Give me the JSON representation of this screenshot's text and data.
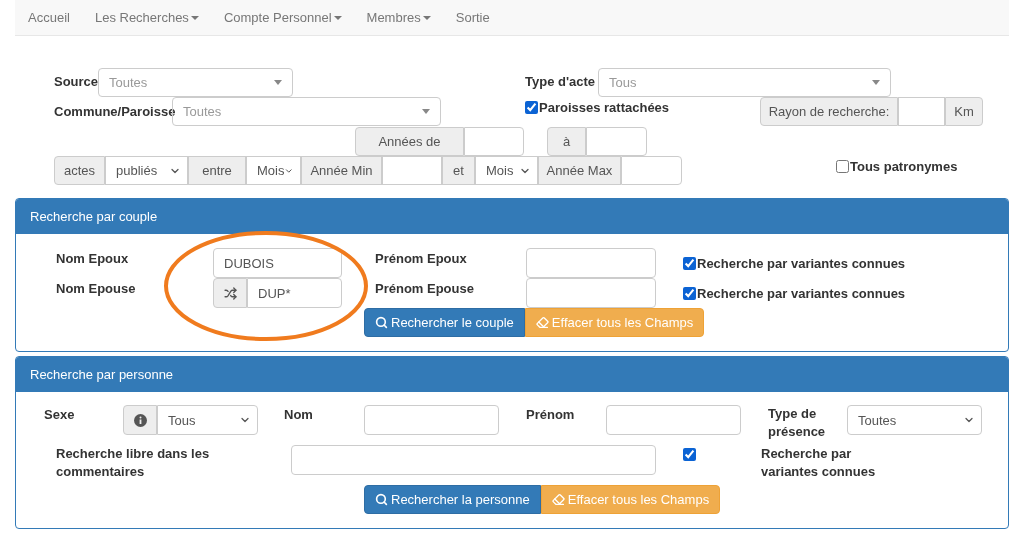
{
  "nav": [
    {
      "label": "Accueil",
      "dropdown": false
    },
    {
      "label": "Les Recherches",
      "dropdown": true
    },
    {
      "label": "Compte Personnel",
      "dropdown": true
    },
    {
      "label": "Membres",
      "dropdown": true
    },
    {
      "label": "Sortie",
      "dropdown": false
    }
  ],
  "filters": {
    "source": {
      "label": "Source",
      "placeholder": "Toutes"
    },
    "type_acte": {
      "label": "Type d'acte",
      "placeholder": "Tous"
    },
    "commune": {
      "label": "Commune/Paroisse",
      "placeholder": "Toutes"
    },
    "paroisses": {
      "label": "Paroisses rattachées",
      "checked": true
    },
    "rayon": {
      "label": "Rayon de recherche:",
      "unit": "Km"
    },
    "annees": {
      "from": "Années de",
      "to": "à"
    },
    "period": [
      {
        "kind": "addon",
        "text": "actes"
      },
      {
        "kind": "select",
        "text": "publiés"
      },
      {
        "kind": "addon",
        "text": "entre"
      },
      {
        "kind": "select",
        "text": "Mois"
      },
      {
        "kind": "addon",
        "text": "Année Min"
      },
      {
        "kind": "input"
      },
      {
        "kind": "addon",
        "text": "et"
      },
      {
        "kind": "select",
        "text": "Mois"
      },
      {
        "kind": "addon",
        "text": "Année Max"
      },
      {
        "kind": "input"
      }
    ],
    "tous_patronymes": {
      "label": "Tous patronymes",
      "checked": false
    }
  },
  "couple": {
    "title": "Recherche par couple",
    "highlight": true,
    "rows": [
      {
        "label": "Nom Epoux",
        "value": "DUBOIS",
        "shuffle": false,
        "first_name_label": "Prénom Epoux",
        "variants": {
          "label": "Recherche par variantes connues",
          "checked": true
        }
      },
      {
        "label": "Nom Epouse",
        "value": "DUP*",
        "shuffle": true,
        "first_name_label": "Prénom Epouse",
        "variants": {
          "label": "Recherche par variantes connues",
          "checked": true
        }
      }
    ],
    "buttons": [
      {
        "kind": "search",
        "label": "Rechercher le couple"
      },
      {
        "kind": "clear",
        "label": "Effacer tous les Champs"
      }
    ]
  },
  "person": {
    "title": "Recherche par personne",
    "sexe": {
      "label": "Sexe",
      "value": "Tous"
    },
    "nom": {
      "label": "Nom"
    },
    "prenom": {
      "label": "Prénom"
    },
    "presence": {
      "label": "Type de présence",
      "value": "Toutes"
    },
    "comment": {
      "label": "Recherche libre dans les commentaires"
    },
    "variants": {
      "label": "Recherche par variantes connues",
      "checked": true
    },
    "buttons": [
      {
        "kind": "search",
        "label": "Rechercher la personne"
      },
      {
        "kind": "clear",
        "label": "Effacer tous les Champs"
      }
    ]
  }
}
